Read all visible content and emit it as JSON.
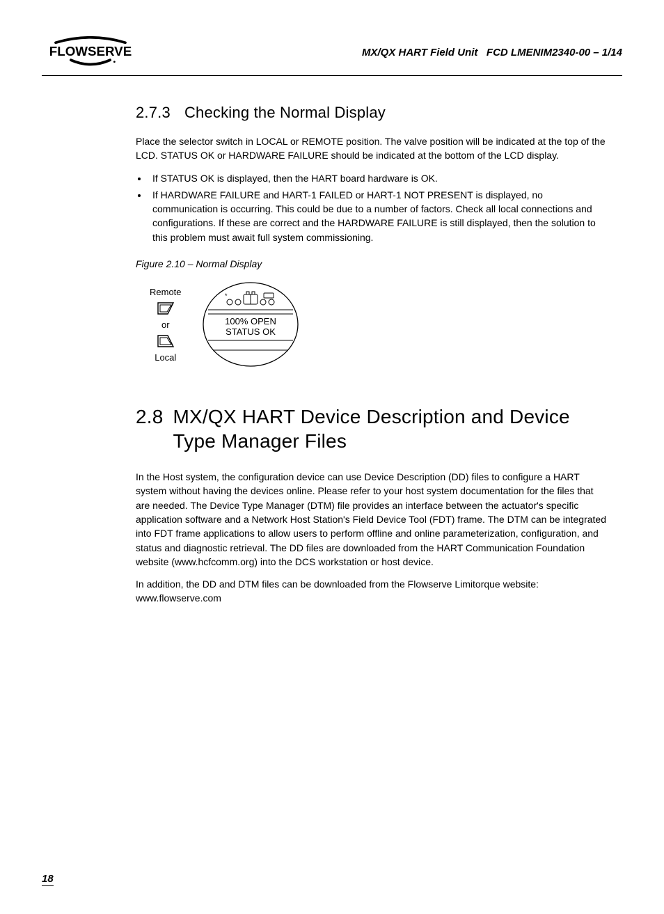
{
  "header": {
    "doc_title": "MX/QX HART Field Unit",
    "doc_code": "FCD LMENIM2340-00 – 1/14"
  },
  "section_273": {
    "number": "2.7.3",
    "title": "Checking the Normal Display",
    "para": "Place the selector switch in LOCAL or REMOTE position. The valve position will be indicated at the top of the LCD. STATUS OK or HARDWARE FAILURE should be indicated at the bottom of the LCD display.",
    "bullets": [
      "If STATUS OK is displayed, then the HART board hardware is OK.",
      "If HARDWARE FAILURE and HART-1 FAILED or HART-1 NOT PRESENT is displayed, no communication is occurring. This could be due to a number of factors. Check all local connections and configurations. If these are correct and the HARDWARE FAILURE is still displayed, then the solution to this problem must await full system commissioning."
    ]
  },
  "figure": {
    "caption": "Figure 2.10 – Normal Display",
    "remote_label": "Remote",
    "or_label": "or",
    "local_label": "Local",
    "lcd_line1": "100% OPEN",
    "lcd_line2": "STATUS OK"
  },
  "section_28": {
    "number": "2.8",
    "title": "MX/QX HART Device Description and Device Type Manager Files",
    "para1": "In the Host system, the configuration device can use Device Description (DD) files to configure a HART system without having the devices online. Please refer to your host system documentation for the files that are needed. The Device Type Manager (DTM) file provides an interface between the actuator's specific application software and a Network Host Station's Field Device Tool (FDT) frame. The DTM can be integrated into FDT frame applications to allow users to perform offline and online parameterization, configuration, and status and diagnostic retrieval. The DD files are downloaded from the HART Communication Foundation website (www.hcfcomm.org) into the DCS workstation or host device.",
    "para2": "In addition, the DD and DTM files can be downloaded from the Flowserve Limitorque website: www.flowserve.com"
  },
  "page_number": "18"
}
